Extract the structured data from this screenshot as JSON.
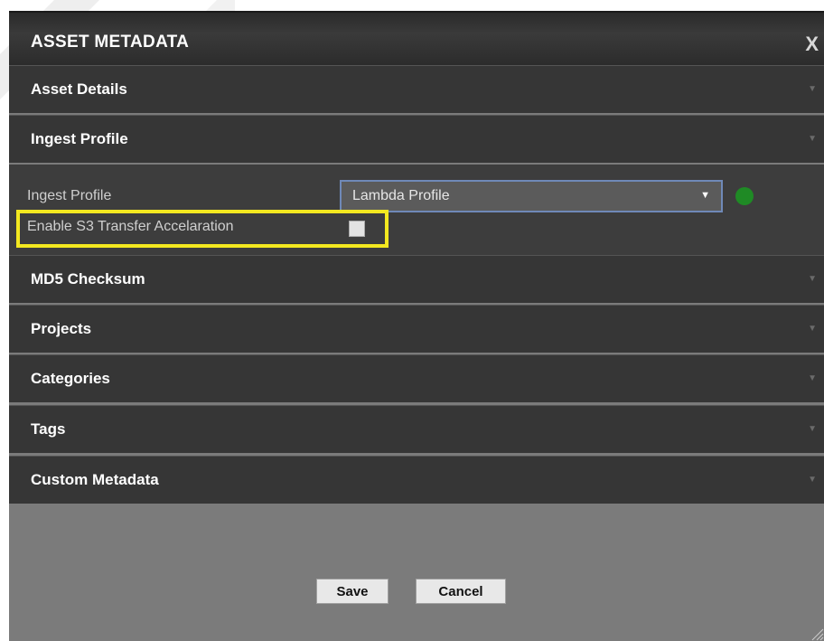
{
  "dialog": {
    "title": "ASSET METADATA",
    "close_label": "X"
  },
  "sections": [
    {
      "label": "Asset Details",
      "expanded": false
    },
    {
      "label": "Ingest Profile",
      "expanded": true
    },
    {
      "label": "MD5 Checksum",
      "expanded": false
    },
    {
      "label": "Projects",
      "expanded": false
    },
    {
      "label": "Categories",
      "expanded": false
    },
    {
      "label": "Tags",
      "expanded": false
    },
    {
      "label": "Custom Metadata",
      "expanded": false
    }
  ],
  "ingest_profile": {
    "profile_label": "Ingest Profile",
    "profile_value": "Lambda Profile",
    "status_color": "#1f8a25",
    "s3_label": "Enable S3 Transfer Accelaration",
    "s3_checked": false,
    "highlight_color": "#f3e820"
  },
  "buttons": {
    "save": "Save",
    "cancel": "Cancel"
  },
  "icons": {
    "section_caret": "caret-down-icon",
    "select_arrow": "dropdown-arrow-icon",
    "close": "close-icon",
    "resize": "resize-grip-icon"
  }
}
